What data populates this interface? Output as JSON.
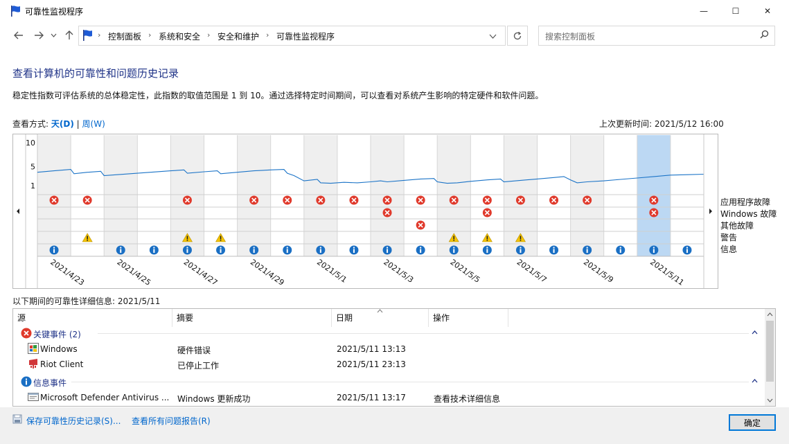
{
  "window": {
    "title": "可靠性监视程序",
    "min_glyph": "—",
    "max_glyph": "☐",
    "close_glyph": "✕"
  },
  "address": {
    "crumbs": [
      "控制面板",
      "系统和安全",
      "安全和维护",
      "可靠性监视程序"
    ],
    "search_placeholder": "搜索控制面板"
  },
  "content": {
    "heading": "查看计算机的可靠性和问题历史记录",
    "description": "稳定性指数可评估系统的总体稳定性，此指数的取值范围是 1 到 10。通过选择特定时间期间，可以查看对系统产生影响的特定硬件和软件问题。",
    "view_by_label": "查看方式:",
    "view_day": "天(D)",
    "view_sep": "|",
    "view_week": "周(W)",
    "last_updated": "上次更新时间: 2021/5/12 16:00"
  },
  "chart_data": {
    "type": "line",
    "y_ticks": [
      "10",
      "5",
      "1"
    ],
    "ylim": [
      1,
      10
    ],
    "x_labels": [
      "2021/4/23",
      "2021/4/25",
      "2021/4/27",
      "2021/4/29",
      "2021/5/1",
      "2021/5/3",
      "2021/5/5",
      "2021/5/7",
      "2021/5/9",
      "2021/5/11"
    ],
    "days": 20,
    "selected_day_index": 18,
    "stability_index": [
      [
        0.0,
        3.8
      ],
      [
        0.5,
        4.1
      ],
      [
        1.0,
        4.4
      ],
      [
        1.1,
        3.5
      ],
      [
        1.5,
        3.8
      ],
      [
        1.9,
        4.0
      ],
      [
        2.0,
        3.1
      ],
      [
        3.0,
        3.6
      ],
      [
        4.0,
        4.1
      ],
      [
        4.4,
        4.3
      ],
      [
        4.5,
        3.6
      ],
      [
        5.0,
        3.9
      ],
      [
        5.4,
        4.1
      ],
      [
        5.5,
        3.5
      ],
      [
        6.5,
        4.1
      ],
      [
        7.0,
        4.3
      ],
      [
        7.4,
        4.4
      ],
      [
        7.5,
        3.6
      ],
      [
        7.7,
        3.1
      ],
      [
        8.0,
        2.0
      ],
      [
        8.4,
        2.3
      ],
      [
        8.5,
        1.6
      ],
      [
        8.8,
        1.5
      ],
      [
        9.2,
        1.7
      ],
      [
        9.6,
        1.6
      ],
      [
        10.0,
        1.8
      ],
      [
        10.3,
        2.0
      ],
      [
        10.5,
        1.8
      ],
      [
        11.0,
        2.1
      ],
      [
        11.5,
        2.4
      ],
      [
        11.9,
        2.5
      ],
      [
        12.0,
        1.8
      ],
      [
        12.3,
        1.5
      ],
      [
        12.6,
        1.6
      ],
      [
        13.0,
        1.9
      ],
      [
        13.5,
        2.2
      ],
      [
        13.9,
        2.4
      ],
      [
        14.0,
        1.8
      ],
      [
        14.5,
        2.1
      ],
      [
        15.0,
        2.4
      ],
      [
        15.5,
        2.7
      ],
      [
        15.8,
        2.9
      ],
      [
        16.0,
        2.2
      ],
      [
        16.2,
        1.6
      ],
      [
        16.5,
        1.8
      ],
      [
        17.0,
        2.0
      ],
      [
        17.5,
        2.3
      ],
      [
        18.0,
        2.6
      ],
      [
        18.5,
        2.9
      ],
      [
        19.0,
        3.2
      ],
      [
        19.5,
        3.3
      ],
      [
        20.0,
        3.4
      ]
    ],
    "rows": [
      "应用程序故障",
      "Windows 故障",
      "其他故障",
      "警告",
      "信息"
    ],
    "events": {
      "app_failure": [
        0,
        1,
        4,
        6,
        7,
        8,
        9,
        10,
        11,
        12,
        13,
        14,
        15,
        16,
        18
      ],
      "windows_failure": [
        10,
        13,
        18
      ],
      "other_failure": [
        11
      ],
      "warning": [
        1,
        4,
        5,
        12,
        13,
        14
      ],
      "info": [
        0,
        2,
        3,
        4,
        5,
        6,
        7,
        8,
        9,
        10,
        11,
        12,
        13,
        14,
        15,
        16,
        17,
        18,
        19
      ]
    },
    "line_color": "#1a73c7",
    "selected_color": "#bcd8f3",
    "shade_color": "#efefef"
  },
  "details": {
    "label": "以下期间的可靠性详细信息: 2021/5/11",
    "columns": [
      "源",
      "摘要",
      "日期",
      "操作"
    ],
    "groups": [
      {
        "name": "关键事件 (2)",
        "rows": [
          {
            "source": "Windows",
            "summary": "硬件错误",
            "date": "2021/5/11 13:13",
            "action": ""
          },
          {
            "source": "Riot Client",
            "summary": "已停止工作",
            "date": "2021/5/11 23:13",
            "action": ""
          }
        ]
      },
      {
        "name": "信息事件",
        "rows": [
          {
            "source": "Microsoft Defender Antivirus ...",
            "summary": "Windows 更新成功",
            "date": "2021/5/11 13:17",
            "action": "查看技术详细信息"
          }
        ]
      }
    ]
  },
  "footer": {
    "save_link": "保存可靠性历史记录(S)...",
    "reports_link": "查看所有问题报告(R)",
    "ok": "确定"
  },
  "colors": {
    "accent": "#0078d7",
    "heading": "#1e3287",
    "link": "#0066cc",
    "error": "#e0392b",
    "warning": "#f5c400",
    "info": "#1a6fc4"
  }
}
